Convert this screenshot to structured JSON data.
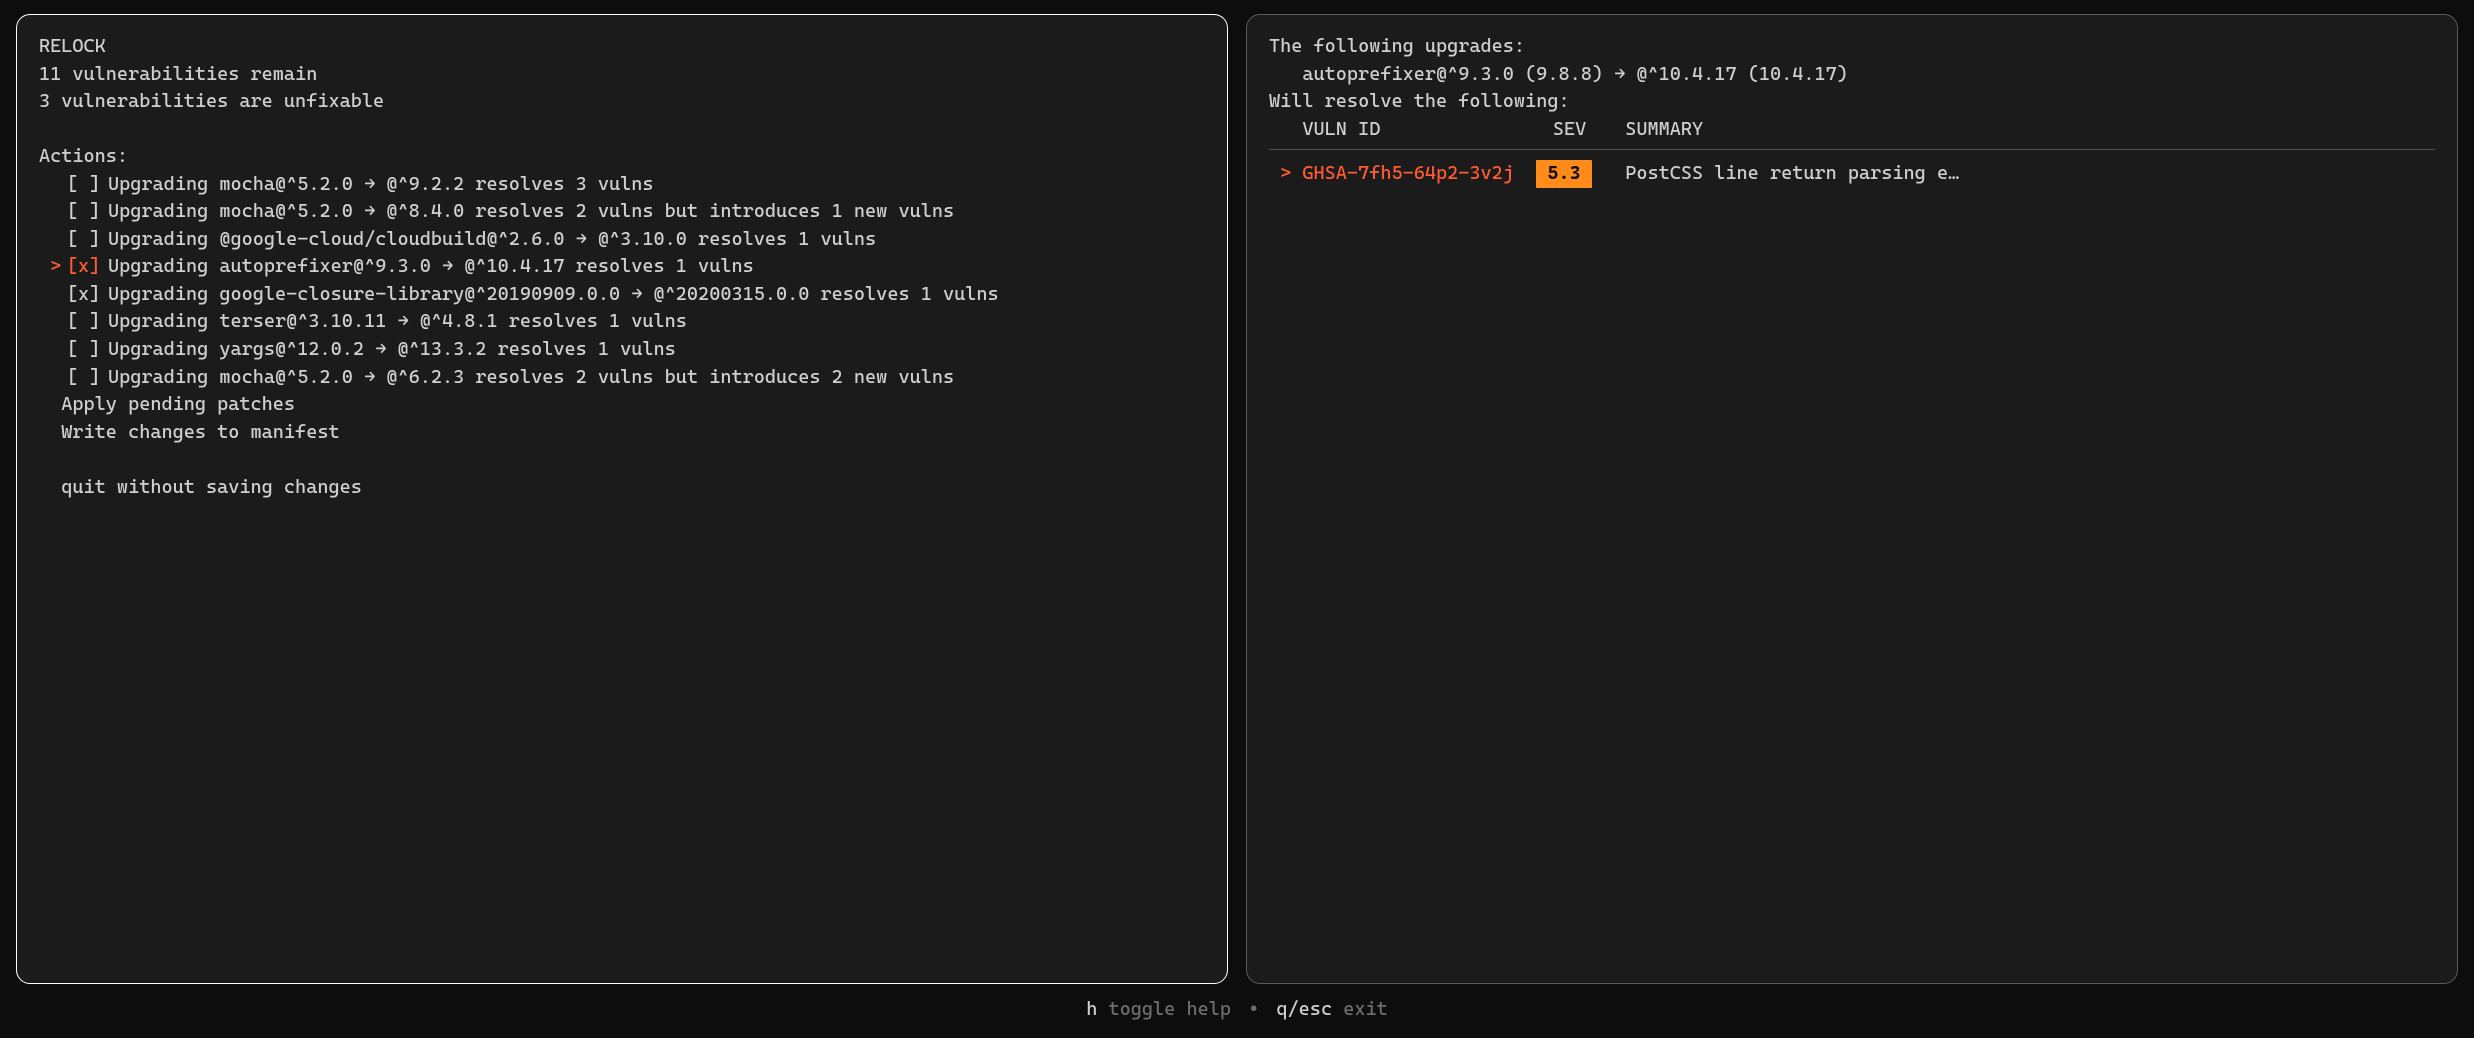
{
  "left": {
    "title": "RELOCK",
    "remain": "11 vulnerabilities remain",
    "unfixable": "3 vulnerabilities are unfixable",
    "actions_label": "Actions:",
    "actions": [
      {
        "checked": false,
        "selected": false,
        "text": "Upgrading mocha@^5.2.0 → @^9.2.2 resolves 3 vulns"
      },
      {
        "checked": false,
        "selected": false,
        "text": "Upgrading mocha@^5.2.0 → @^8.4.0 resolves 2 vulns but introduces 1 new vulns"
      },
      {
        "checked": false,
        "selected": false,
        "text": "Upgrading @google-cloud/cloudbuild@^2.6.0 → @^3.10.0 resolves 1 vulns"
      },
      {
        "checked": true,
        "selected": true,
        "text": "Upgrading autoprefixer@^9.3.0 → @^10.4.17 resolves 1 vulns"
      },
      {
        "checked": true,
        "selected": false,
        "text": "Upgrading google-closure-library@^20190909.0.0 → @^20200315.0.0 resolves 1 vulns"
      },
      {
        "checked": false,
        "selected": false,
        "text": "Upgrading terser@^3.10.11 → @^4.8.1 resolves 1 vulns"
      },
      {
        "checked": false,
        "selected": false,
        "text": "Upgrading yargs@^12.0.2 → @^13.3.2 resolves 1 vulns"
      },
      {
        "checked": false,
        "selected": false,
        "text": "Upgrading mocha@^5.2.0 → @^6.2.3 resolves 2 vulns but introduces 2 new vulns"
      }
    ],
    "apply": "Apply pending patches",
    "write": "Write changes to manifest",
    "quit": "quit without saving changes"
  },
  "right": {
    "upgrades_label": "The following upgrades:",
    "upgrade_line": "autoprefixer@^9.3.0 (9.8.8) → @^10.4.17 (10.4.17)",
    "resolve_label": "Will resolve the following:",
    "headers": {
      "id": "VULN ID",
      "sev": "SEV",
      "sum": "SUMMARY"
    },
    "rows": [
      {
        "id": "GHSA-7fh5-64p2-3v2j",
        "sev": "5.3",
        "summary": "PostCSS line return parsing e…"
      }
    ]
  },
  "footer": {
    "help_key": "h",
    "help_label": "toggle help",
    "sep": "•",
    "quit_key": "q/esc",
    "quit_label": "exit"
  },
  "glyphs": {
    "unchecked": "[ ]",
    "checked": "[x]",
    "caret": ">"
  }
}
